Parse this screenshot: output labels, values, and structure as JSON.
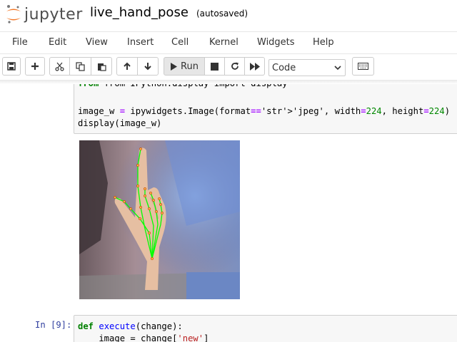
{
  "header": {
    "logo_text": "jupyter",
    "notebook_title": "live_hand_pose",
    "autosave_status": "(autosaved)"
  },
  "menubar": {
    "items": [
      "File",
      "Edit",
      "View",
      "Insert",
      "Cell",
      "Kernel",
      "Widgets",
      "Help"
    ]
  },
  "toolbar": {
    "run_label": "Run",
    "cell_type": "Code",
    "icons": [
      "save-icon",
      "plus-icon",
      "scissors-icon",
      "copy-icon",
      "paste-icon",
      "arrow-up-icon",
      "arrow-down-icon",
      "play-icon",
      "stop-icon",
      "restart-icon",
      "fast-forward-icon",
      "keyboard-icon"
    ]
  },
  "cells": {
    "cell1": {
      "partial_line": "from IPython.display import display",
      "line1": "image_w = ipywidgets.Image(format='jpeg', width=224, height=224)",
      "line2": "display(image_w)"
    },
    "cell2": {
      "prompt": "In [9]:",
      "line1": "def execute(change):",
      "line2": "    image = change['new']"
    }
  },
  "colors": {
    "keyword": "#008000",
    "string": "#ba2121",
    "prompt": "#303f9f",
    "cell_bg": "#f7f7f7",
    "pose_lines": "#00ff00"
  }
}
